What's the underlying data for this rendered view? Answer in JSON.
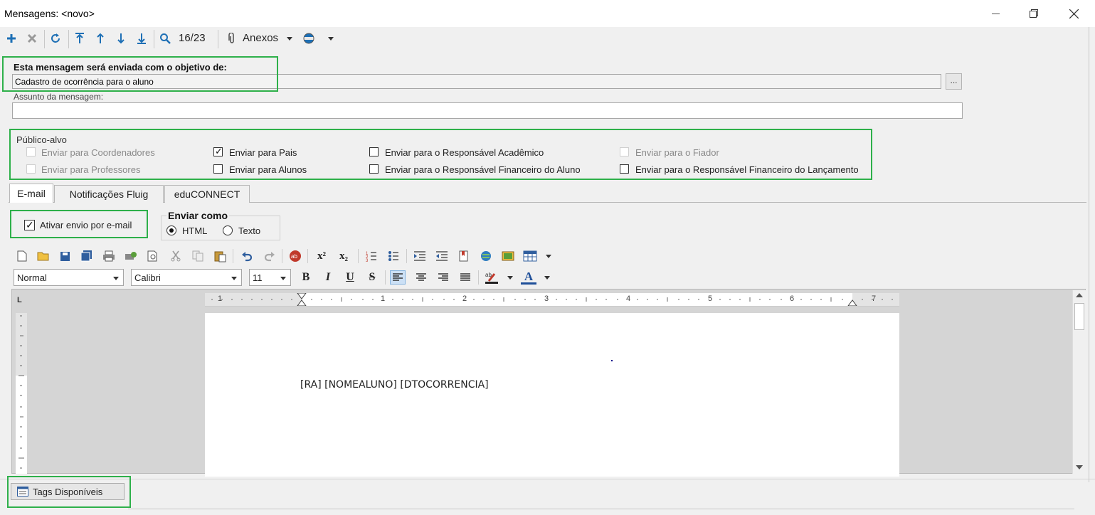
{
  "window": {
    "title": "Mensagens: <novo>",
    "minimize_icon": "minimize-icon",
    "maximize_icon": "restore-icon",
    "close_icon": "close-icon"
  },
  "toolbar": {
    "record_position": "16/23",
    "attachments_label": "Anexos",
    "icons": [
      "add-icon",
      "delete-icon",
      "refresh-icon",
      "first-record-icon",
      "previous-record-icon",
      "next-record-icon",
      "last-record-icon",
      "search-icon",
      "paperclip-icon",
      "globe-icon"
    ]
  },
  "objective": {
    "heading": "Esta mensagem será enviada com o objetivo de:",
    "value": "Cadastro de ocorrência para o aluno",
    "browse_label": "..."
  },
  "subject": {
    "label": "Assunto da mensagem:",
    "value": ""
  },
  "audience": {
    "legend": "Público-alvo",
    "options": [
      {
        "label": "Enviar para Coordenadores",
        "checked": false,
        "enabled": false
      },
      {
        "label": "Enviar para Professores",
        "checked": false,
        "enabled": false
      },
      {
        "label": "Enviar para Pais",
        "checked": true,
        "enabled": true
      },
      {
        "label": "Enviar para Alunos",
        "checked": false,
        "enabled": true
      },
      {
        "label": "Enviar para o Responsável Acadêmico",
        "checked": false,
        "enabled": true
      },
      {
        "label": "Enviar para o Responsável Financeiro do Aluno",
        "checked": false,
        "enabled": true
      },
      {
        "label": "Enviar para o Fiador",
        "checked": false,
        "enabled": false
      },
      {
        "label": "Enviar para o Responsável Financeiro do Lançamento",
        "checked": false,
        "enabled": true
      }
    ]
  },
  "tabs": [
    {
      "label": "E-mail",
      "active": true
    },
    {
      "label": "Notificações Fluig",
      "active": false
    },
    {
      "label": "eduCONNECT",
      "active": false
    }
  ],
  "email": {
    "enable_label": "Ativar envio por e-mail",
    "enable_checked": true,
    "send_as_legend": "Enviar como",
    "send_as_options": [
      {
        "label": "HTML",
        "selected": true
      },
      {
        "label": "Texto",
        "selected": false
      }
    ]
  },
  "editor": {
    "style_value": "Normal",
    "font_value": "Calibri",
    "size_value": "11",
    "bold_label": "B",
    "italic_label": "I",
    "underline_label": "U",
    "strike_label": "S",
    "font_color_label": "A",
    "superscript_label": "x²",
    "subscript_label": "x₂",
    "ruler_numbers": [
      "1",
      "1",
      "2",
      "3",
      "4",
      "5",
      "6",
      "7"
    ],
    "body_text": "[RA] [NOMEALUNO] [DTOCORRENCIA]"
  },
  "footer": {
    "tags_button_label": "Tags Disponíveis"
  },
  "colors": {
    "highlight_border": "#2eb04a",
    "toolbar_icon": "#1d6fb5"
  }
}
